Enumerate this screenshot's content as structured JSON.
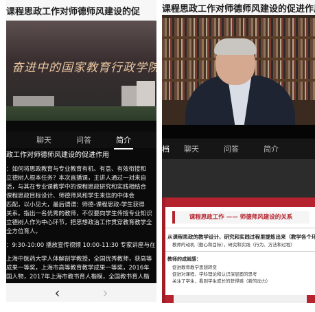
{
  "left": {
    "title": "课程思政工作对师德师风建设的促",
    "banner": "奋进中的国家教育行政学院",
    "tabs": [
      "聊天",
      "问答",
      "简介"
    ],
    "active_tab": 2,
    "intro_heading": "政工作对师德师风建设的促进作用",
    "intro_lines": [
      "：如何将思政教育与专业教育有机、有意、有效衔接和",
      "立德树人根本任务？本次直播课，主讲人通过一对来自",
      "活，与其在专业课教学中的课程思政研究和实践相结合",
      "课程思政目标设计、师德师风和学生来信的中体会",
      "匹配，以小见大，最后谓谓：师德-课程思政-学生获得",
      "关系。指出一名优秀的教师，不仅要向学生传授专业知识",
      "立德树人作为中心环节，把思想政治工作贯穿教育教学全",
      "全方位育人。"
    ],
    "schedule": "：9:30-10:00 播放宣传视频 10:00-11:30 专家讲座与在",
    "speaker_lines": [
      "上海中医药大学人体解剖学教授，全国优秀教师，获高等",
      "成果一等奖，上海市高等教育教学成果一等奖，2016年",
      "国人物，2017年上海市教书育人楷模，全国教书育人楷"
    ],
    "nav": {
      "back": "‹",
      "forward": "›"
    }
  },
  "right": {
    "title": "课程思政工作对师德师风建设的促进作用",
    "tabs": [
      "档",
      "聊天",
      "问答",
      "简介"
    ],
    "active_tab": 0,
    "slide": {
      "title": "课程思政工作 —— 师德师风建设的关系",
      "point1": "从课程思政的教学设计、研究和实践过程里提炼出来（教学各个环节）",
      "point1_sub": "教师的动机（動心和目标），研究和实践（行为、方法和过程）",
      "heading2": "教师的成就感：",
      "lines": [
        "促进教育教学思想转变",
        "促进对课程、学科理论和认识深层面的思考",
        "关注了学生，看到学生成长的获得感（新的动力）"
      ]
    }
  },
  "colors": {
    "accent_red": "#b4232e",
    "dark_bg": "#0a0a0a"
  }
}
